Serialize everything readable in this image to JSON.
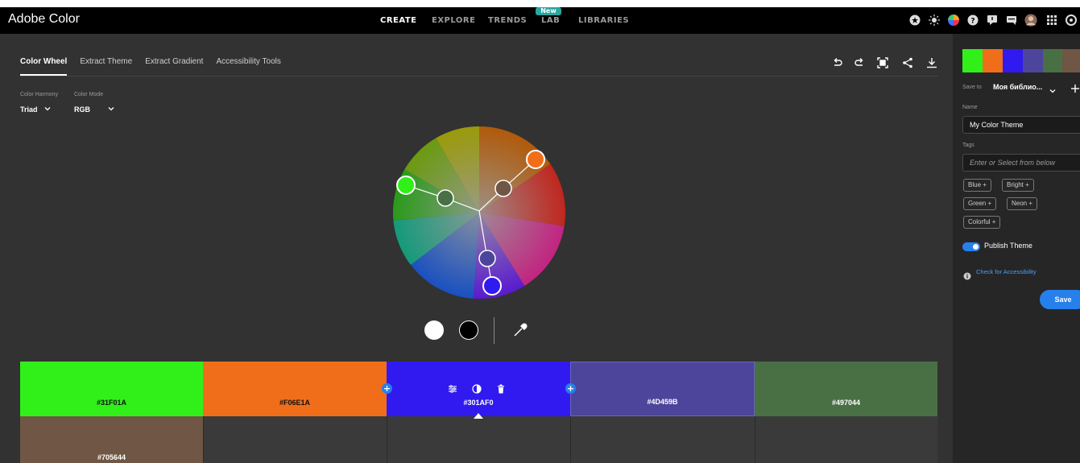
{
  "app": {
    "title": "Adobe Color"
  },
  "nav": {
    "items": [
      {
        "label": "CREATE",
        "active": true
      },
      {
        "label": "EXPLORE",
        "active": false
      },
      {
        "label": "TRENDS",
        "active": false
      },
      {
        "label": "LAB",
        "active": false,
        "badge": "New"
      },
      {
        "label": "LIBRARIES",
        "active": false
      }
    ]
  },
  "header_icons": [
    "star-icon",
    "sun-icon",
    "color-wheel-icon",
    "help-icon",
    "feedback-icon",
    "chat-icon",
    "avatar",
    "apps-grid-icon",
    "creative-cloud-icon"
  ],
  "tabs": [
    {
      "label": "Color Wheel",
      "active": true
    },
    {
      "label": "Extract Theme",
      "active": false
    },
    {
      "label": "Extract Gradient",
      "active": false
    },
    {
      "label": "Accessibility Tools",
      "active": false
    }
  ],
  "toolbar_icons": [
    "undo-icon",
    "redo-icon",
    "fullscreen-icon",
    "share-icon",
    "download-icon"
  ],
  "options": {
    "harmony_label": "Color Harmony",
    "harmony_value": "Triad",
    "mode_label": "Color Mode",
    "mode_value": "RGB"
  },
  "swatches": [
    {
      "hex": "#31F01A",
      "color": "#31f01a"
    },
    {
      "hex": "#F06E1A",
      "color": "#f06e1a"
    },
    {
      "hex": "#301AF0",
      "color": "#301af0",
      "selected": true
    },
    {
      "hex": "#4D459B",
      "color": "#4d459b"
    },
    {
      "hex": "#497044",
      "color": "#497044"
    },
    {
      "hex": "#705644",
      "color": "#705644"
    }
  ],
  "panel": {
    "save_to_label": "Save to",
    "library_name": "Моя библио...",
    "name_label": "Name",
    "name_value": "My Color Theme",
    "tags_label": "Tags",
    "tags_placeholder": "Enter or Select from below",
    "tags": [
      "Blue",
      "Bright",
      "Green",
      "Neon",
      "Colorful"
    ],
    "publish_label": "Publish Theme",
    "publish_on": true,
    "accessibility_link": "Check for Accessibility",
    "save_label": "Save"
  }
}
